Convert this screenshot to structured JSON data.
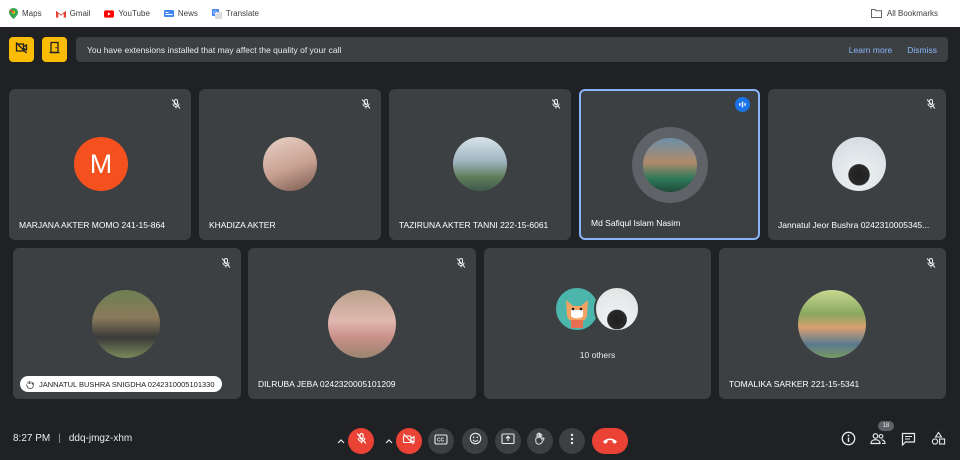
{
  "bookmarks": {
    "items": [
      {
        "label": "Maps",
        "icon": "maps-icon"
      },
      {
        "label": "Gmail",
        "icon": "gmail-icon"
      },
      {
        "label": "YouTube",
        "icon": "youtube-icon"
      },
      {
        "label": "News",
        "icon": "news-icon"
      },
      {
        "label": "Translate",
        "icon": "translate-icon"
      }
    ],
    "all_label": "All Bookmarks"
  },
  "banner": {
    "message": "You have extensions installed that may affect the quality of your call",
    "learn_more": "Learn more",
    "dismiss": "Dismiss"
  },
  "participants": [
    {
      "name": "MARJANA AKTER MOMO 241-15-864",
      "initial": "M",
      "avatar_color": "#f4511e",
      "mic": "off"
    },
    {
      "name": "KHADIZA AKTER",
      "avatar_color": "#d7b8a8",
      "mic": "off"
    },
    {
      "name": "TAZIRUNA AKTER TANNI 222-15-6061",
      "avatar_color": "#8fa8b8",
      "mic": "off"
    },
    {
      "name": "Md Safiqul Islam Nasim",
      "avatar_color": "#4a8a6a",
      "mic": "speaking"
    },
    {
      "name": "Jannatul Jeor Bushra 0242310005345...",
      "avatar_color": "#cfd8dc",
      "mic": "off"
    },
    {
      "name": "JANNATUL BUSHRA SNIGDHA 0242310005101330",
      "avatar_color": "#7a8a5a",
      "mic": "off"
    },
    {
      "name": "DILRUBA JEBA 0242320005101209",
      "avatar_color": "#c8a098",
      "mic": "off"
    },
    {
      "name": "TOMALIKA SARKER 221-15-5341",
      "avatar_color": "#a8b870",
      "mic": "off"
    }
  ],
  "others": {
    "label": "10 others",
    "avatar1_color": "#4db6ac",
    "avatar2_color": "#e0e0e0"
  },
  "meeting": {
    "time": "8:27 PM",
    "code": "ddq-jmgz-xhm"
  },
  "people_count": "18",
  "colors": {
    "accent": "#8ab4f8",
    "danger": "#ea4335",
    "tile": "#3c4043",
    "bg": "#202124",
    "warning": "#fbbc04"
  }
}
